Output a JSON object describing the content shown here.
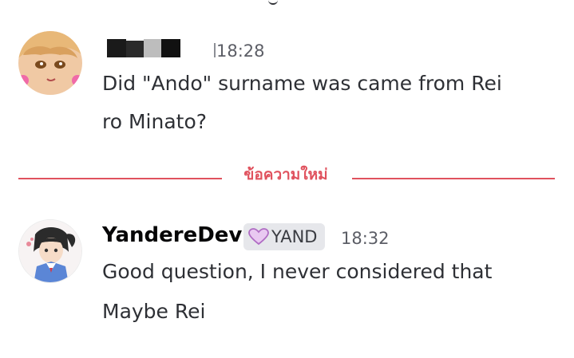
{
  "messages": [
    {
      "timestamp": "18:28",
      "lines": [
        "Did \"Ando\" surname was came from Rei",
        "ro Minato?"
      ]
    },
    {
      "author": "YandereDev",
      "role_tag": "YAND",
      "timestamp": "18:32",
      "lines": [
        "Good question, I never considered that",
        "Maybe Rei"
      ]
    }
  ],
  "divider": {
    "label": "ข้อความใหม่"
  },
  "colors": {
    "accent": "#e0525e",
    "tag_bg": "#e6e7eb",
    "heart": "#c37bd3"
  },
  "icons": [
    "heart-icon"
  ]
}
